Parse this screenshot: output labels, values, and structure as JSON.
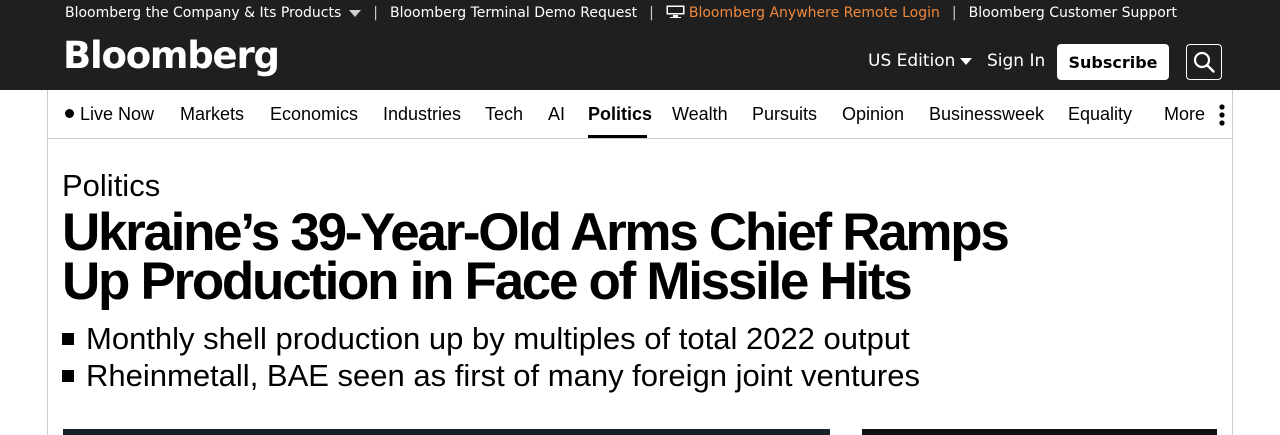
{
  "utility_bar": {
    "items": [
      {
        "label": "Bloomberg the Company & Its Products"
      },
      {
        "label": "Bloomberg Terminal Demo Request"
      },
      {
        "label": "Bloomberg Anywhere Remote Login"
      },
      {
        "label": "Bloomberg Customer Support"
      }
    ],
    "separator": "|",
    "accent_color": "#f0883a"
  },
  "header": {
    "logo": "Bloomberg",
    "edition": "US Edition",
    "sign_in": "Sign In",
    "subscribe": "Subscribe",
    "search_icon": "search-icon"
  },
  "nav": {
    "items": [
      {
        "label": "Live Now"
      },
      {
        "label": "Markets"
      },
      {
        "label": "Economics"
      },
      {
        "label": "Industries"
      },
      {
        "label": "Tech"
      },
      {
        "label": "AI"
      },
      {
        "label": "Politics",
        "active": true
      },
      {
        "label": "Wealth"
      },
      {
        "label": "Pursuits"
      },
      {
        "label": "Opinion"
      },
      {
        "label": "Businessweek"
      },
      {
        "label": "Equality"
      },
      {
        "label": "More"
      }
    ],
    "more_icon": "vertical-dots-icon"
  },
  "article": {
    "kicker": "Politics",
    "headline_line1": "Ukraine’s 39-Year-Old Arms Chief Ramps",
    "headline_line2": "Up Production in Face of Missile Hits",
    "bullets": [
      "Monthly shell production up by multiples of total 2022 output",
      "Rheinmetall, BAE seen as first of many foreign joint ventures"
    ]
  }
}
